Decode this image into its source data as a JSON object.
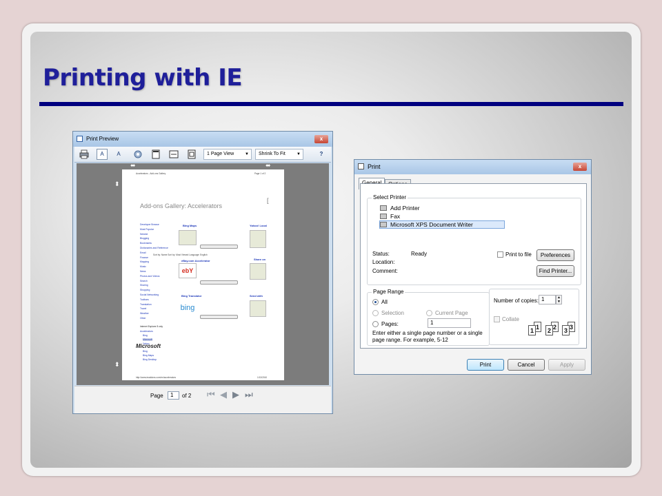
{
  "slide": {
    "title": "Printing with IE"
  },
  "print_preview": {
    "window_title": "Print Preview",
    "close_label": "x",
    "toolbar": {
      "page_view": "1 Page View",
      "shrink": "Shrink To Fit",
      "help": "?"
    },
    "page": {
      "header_left": "Accelerators - Add-ons Gallery",
      "header_right": "Page 1 of 2",
      "heading": "Add-ons Gallery: Accelerators",
      "footer_left": "http://www.ieaddons.com/en/accelerators",
      "footer_right": "1/13/2010",
      "categories": [
        "Developer Browse",
        "Most Popular",
        "Newest",
        "Blogging",
        "Bookmarks",
        "Dictionaries and Reference",
        "Email",
        "Finance",
        "Mapping",
        "Music",
        "News",
        "Photos and Videos",
        "Search",
        "Sharing",
        "Shopping",
        "Social Networking",
        "Toolbars",
        "Translation",
        "Travel",
        "Weather",
        "Other"
      ],
      "sidebar_extra": [
        "Internet Explorer 8 only",
        "Accelerators",
        "Bing",
        "Microsoft",
        "Yahoo"
      ],
      "sidebar_bottom": [
        "Bing",
        "Bing Maps",
        "Bing Desktop"
      ],
      "filter_text": "Sort by: Name  Sort by: Most Viewed  Language: English",
      "items": [
        "Bing Maps",
        "eBay.com Accelerator",
        "Bing Translator",
        "Yahoo! Local",
        "Share on",
        "Send with"
      ],
      "logos": [
        "bing",
        "ebY"
      ]
    },
    "footer": {
      "page_label": "Page",
      "page_value": "1",
      "of_label": "of 2"
    }
  },
  "print_dialog": {
    "window_title": "Print",
    "close_label": "x",
    "tabs": [
      "General",
      "Options"
    ],
    "select_printer_label": "Select Printer",
    "printers": [
      "Add Printer",
      "Fax",
      "Microsoft XPS Document Writer"
    ],
    "status_label": "Status:",
    "status_value": "Ready",
    "location_label": "Location:",
    "comment_label": "Comment:",
    "print_to_file_label": "Print to file",
    "preferences_button": "Preferences",
    "find_printer_button": "Find Printer...",
    "page_range": {
      "label": "Page Range",
      "all": "All",
      "selection": "Selection",
      "current_page": "Current Page",
      "pages": "Pages:",
      "pages_value": "1",
      "hint_line1": "Enter either a single page number or a single",
      "hint_line2": "page range.  For example, 5-12"
    },
    "copies": {
      "label": "Number of copies:",
      "value": "1",
      "collate_label": "Collate"
    },
    "buttons": {
      "print": "Print",
      "cancel": "Cancel",
      "apply": "Apply"
    },
    "collate_digits": [
      "1",
      "1",
      "2",
      "2",
      "3",
      "3"
    ]
  }
}
